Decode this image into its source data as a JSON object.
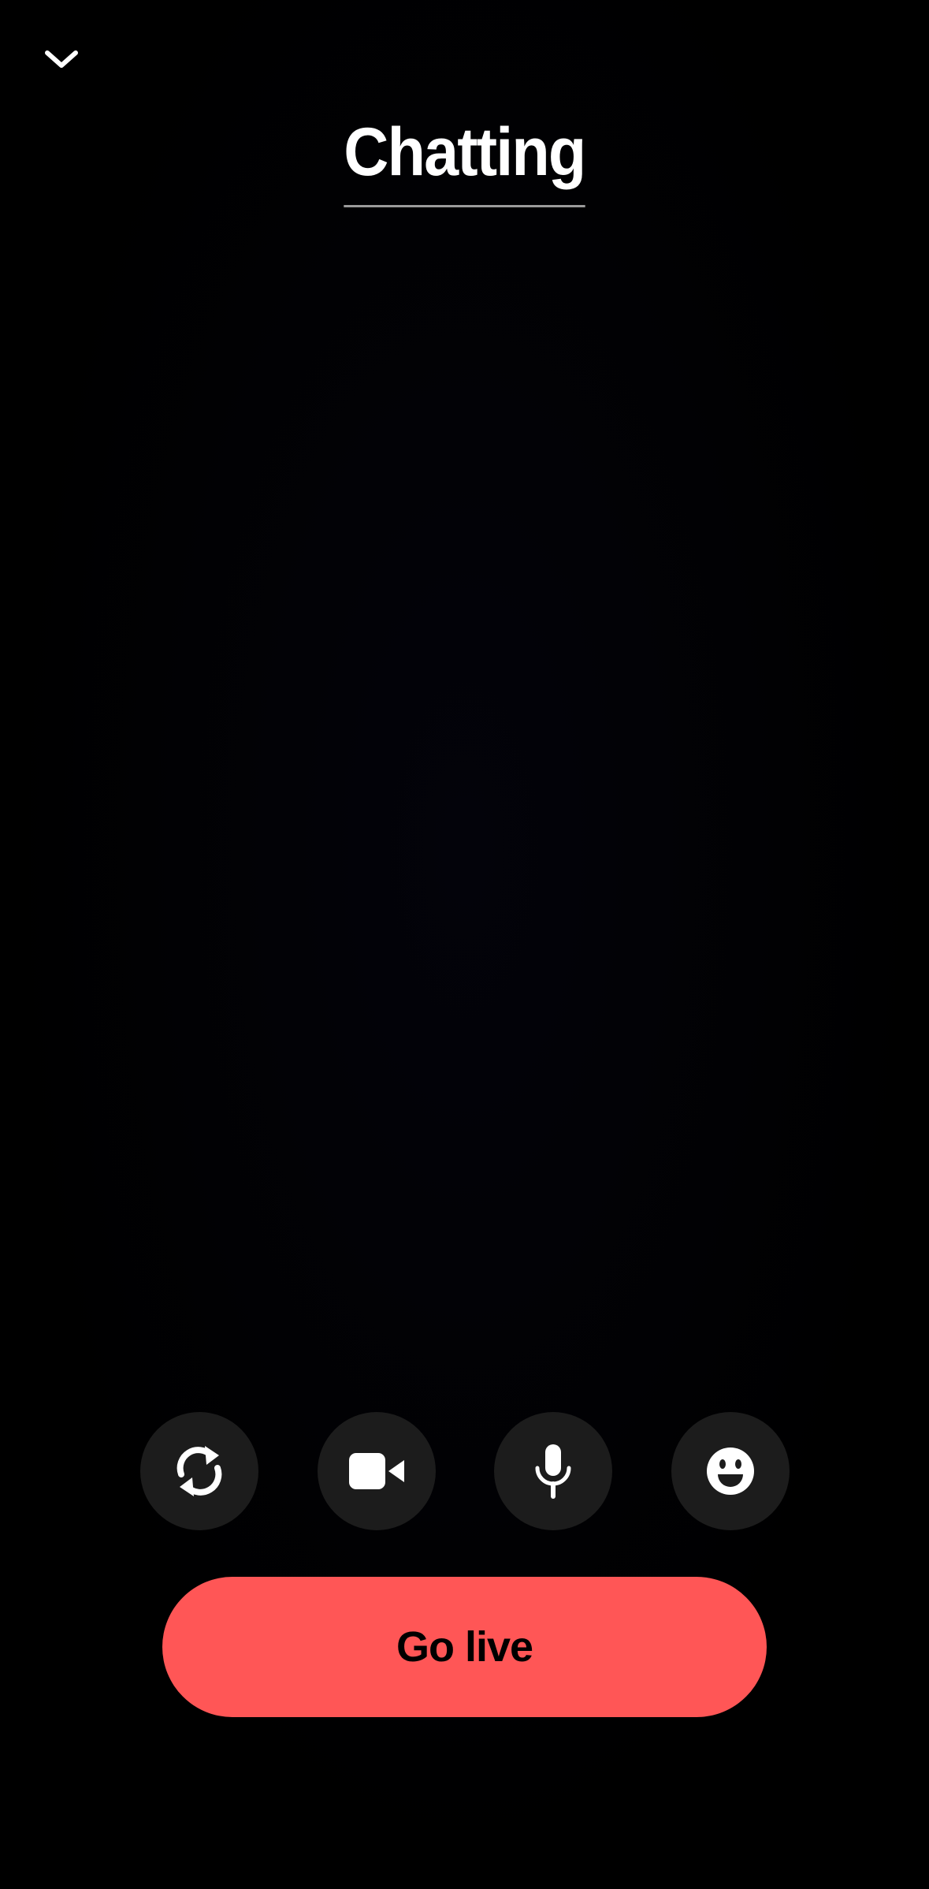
{
  "header": {
    "collapse_icon": "chevron-down-icon",
    "title": "Chatting"
  },
  "controls": [
    {
      "name": "flip-camera-button",
      "icon": "flip-camera-icon"
    },
    {
      "name": "video-button",
      "icon": "video-camera-icon"
    },
    {
      "name": "microphone-button",
      "icon": "microphone-icon"
    },
    {
      "name": "effects-button",
      "icon": "smiley-icon"
    }
  ],
  "go_live": {
    "label": "Go live",
    "color": "#ff5656"
  },
  "colors": {
    "background": "#000000",
    "control_bg": "#1c1c1c",
    "accent": "#ff5656"
  }
}
